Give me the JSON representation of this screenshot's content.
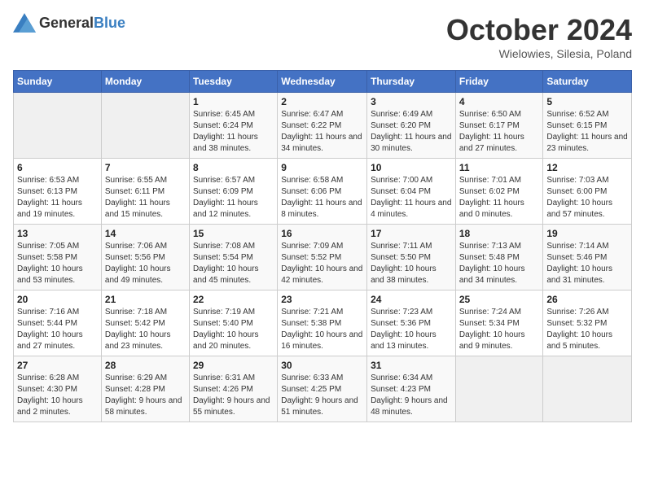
{
  "header": {
    "logo_general": "General",
    "logo_blue": "Blue",
    "month": "October 2024",
    "location": "Wielowies, Silesia, Poland"
  },
  "weekdays": [
    "Sunday",
    "Monday",
    "Tuesday",
    "Wednesday",
    "Thursday",
    "Friday",
    "Saturday"
  ],
  "weeks": [
    [
      {
        "day": "",
        "empty": true
      },
      {
        "day": "",
        "empty": true
      },
      {
        "day": "1",
        "sunrise": "Sunrise: 6:45 AM",
        "sunset": "Sunset: 6:24 PM",
        "daylight": "Daylight: 11 hours and 38 minutes."
      },
      {
        "day": "2",
        "sunrise": "Sunrise: 6:47 AM",
        "sunset": "Sunset: 6:22 PM",
        "daylight": "Daylight: 11 hours and 34 minutes."
      },
      {
        "day": "3",
        "sunrise": "Sunrise: 6:49 AM",
        "sunset": "Sunset: 6:20 PM",
        "daylight": "Daylight: 11 hours and 30 minutes."
      },
      {
        "day": "4",
        "sunrise": "Sunrise: 6:50 AM",
        "sunset": "Sunset: 6:17 PM",
        "daylight": "Daylight: 11 hours and 27 minutes."
      },
      {
        "day": "5",
        "sunrise": "Sunrise: 6:52 AM",
        "sunset": "Sunset: 6:15 PM",
        "daylight": "Daylight: 11 hours and 23 minutes."
      }
    ],
    [
      {
        "day": "6",
        "sunrise": "Sunrise: 6:53 AM",
        "sunset": "Sunset: 6:13 PM",
        "daylight": "Daylight: 11 hours and 19 minutes."
      },
      {
        "day": "7",
        "sunrise": "Sunrise: 6:55 AM",
        "sunset": "Sunset: 6:11 PM",
        "daylight": "Daylight: 11 hours and 15 minutes."
      },
      {
        "day": "8",
        "sunrise": "Sunrise: 6:57 AM",
        "sunset": "Sunset: 6:09 PM",
        "daylight": "Daylight: 11 hours and 12 minutes."
      },
      {
        "day": "9",
        "sunrise": "Sunrise: 6:58 AM",
        "sunset": "Sunset: 6:06 PM",
        "daylight": "Daylight: 11 hours and 8 minutes."
      },
      {
        "day": "10",
        "sunrise": "Sunrise: 7:00 AM",
        "sunset": "Sunset: 6:04 PM",
        "daylight": "Daylight: 11 hours and 4 minutes."
      },
      {
        "day": "11",
        "sunrise": "Sunrise: 7:01 AM",
        "sunset": "Sunset: 6:02 PM",
        "daylight": "Daylight: 11 hours and 0 minutes."
      },
      {
        "day": "12",
        "sunrise": "Sunrise: 7:03 AM",
        "sunset": "Sunset: 6:00 PM",
        "daylight": "Daylight: 10 hours and 57 minutes."
      }
    ],
    [
      {
        "day": "13",
        "sunrise": "Sunrise: 7:05 AM",
        "sunset": "Sunset: 5:58 PM",
        "daylight": "Daylight: 10 hours and 53 minutes."
      },
      {
        "day": "14",
        "sunrise": "Sunrise: 7:06 AM",
        "sunset": "Sunset: 5:56 PM",
        "daylight": "Daylight: 10 hours and 49 minutes."
      },
      {
        "day": "15",
        "sunrise": "Sunrise: 7:08 AM",
        "sunset": "Sunset: 5:54 PM",
        "daylight": "Daylight: 10 hours and 45 minutes."
      },
      {
        "day": "16",
        "sunrise": "Sunrise: 7:09 AM",
        "sunset": "Sunset: 5:52 PM",
        "daylight": "Daylight: 10 hours and 42 minutes."
      },
      {
        "day": "17",
        "sunrise": "Sunrise: 7:11 AM",
        "sunset": "Sunset: 5:50 PM",
        "daylight": "Daylight: 10 hours and 38 minutes."
      },
      {
        "day": "18",
        "sunrise": "Sunrise: 7:13 AM",
        "sunset": "Sunset: 5:48 PM",
        "daylight": "Daylight: 10 hours and 34 minutes."
      },
      {
        "day": "19",
        "sunrise": "Sunrise: 7:14 AM",
        "sunset": "Sunset: 5:46 PM",
        "daylight": "Daylight: 10 hours and 31 minutes."
      }
    ],
    [
      {
        "day": "20",
        "sunrise": "Sunrise: 7:16 AM",
        "sunset": "Sunset: 5:44 PM",
        "daylight": "Daylight: 10 hours and 27 minutes."
      },
      {
        "day": "21",
        "sunrise": "Sunrise: 7:18 AM",
        "sunset": "Sunset: 5:42 PM",
        "daylight": "Daylight: 10 hours and 23 minutes."
      },
      {
        "day": "22",
        "sunrise": "Sunrise: 7:19 AM",
        "sunset": "Sunset: 5:40 PM",
        "daylight": "Daylight: 10 hours and 20 minutes."
      },
      {
        "day": "23",
        "sunrise": "Sunrise: 7:21 AM",
        "sunset": "Sunset: 5:38 PM",
        "daylight": "Daylight: 10 hours and 16 minutes."
      },
      {
        "day": "24",
        "sunrise": "Sunrise: 7:23 AM",
        "sunset": "Sunset: 5:36 PM",
        "daylight": "Daylight: 10 hours and 13 minutes."
      },
      {
        "day": "25",
        "sunrise": "Sunrise: 7:24 AM",
        "sunset": "Sunset: 5:34 PM",
        "daylight": "Daylight: 10 hours and 9 minutes."
      },
      {
        "day": "26",
        "sunrise": "Sunrise: 7:26 AM",
        "sunset": "Sunset: 5:32 PM",
        "daylight": "Daylight: 10 hours and 5 minutes."
      }
    ],
    [
      {
        "day": "27",
        "sunrise": "Sunrise: 6:28 AM",
        "sunset": "Sunset: 4:30 PM",
        "daylight": "Daylight: 10 hours and 2 minutes."
      },
      {
        "day": "28",
        "sunrise": "Sunrise: 6:29 AM",
        "sunset": "Sunset: 4:28 PM",
        "daylight": "Daylight: 9 hours and 58 minutes."
      },
      {
        "day": "29",
        "sunrise": "Sunrise: 6:31 AM",
        "sunset": "Sunset: 4:26 PM",
        "daylight": "Daylight: 9 hours and 55 minutes."
      },
      {
        "day": "30",
        "sunrise": "Sunrise: 6:33 AM",
        "sunset": "Sunset: 4:25 PM",
        "daylight": "Daylight: 9 hours and 51 minutes."
      },
      {
        "day": "31",
        "sunrise": "Sunrise: 6:34 AM",
        "sunset": "Sunset: 4:23 PM",
        "daylight": "Daylight: 9 hours and 48 minutes."
      },
      {
        "day": "",
        "empty": true
      },
      {
        "day": "",
        "empty": true
      }
    ]
  ]
}
